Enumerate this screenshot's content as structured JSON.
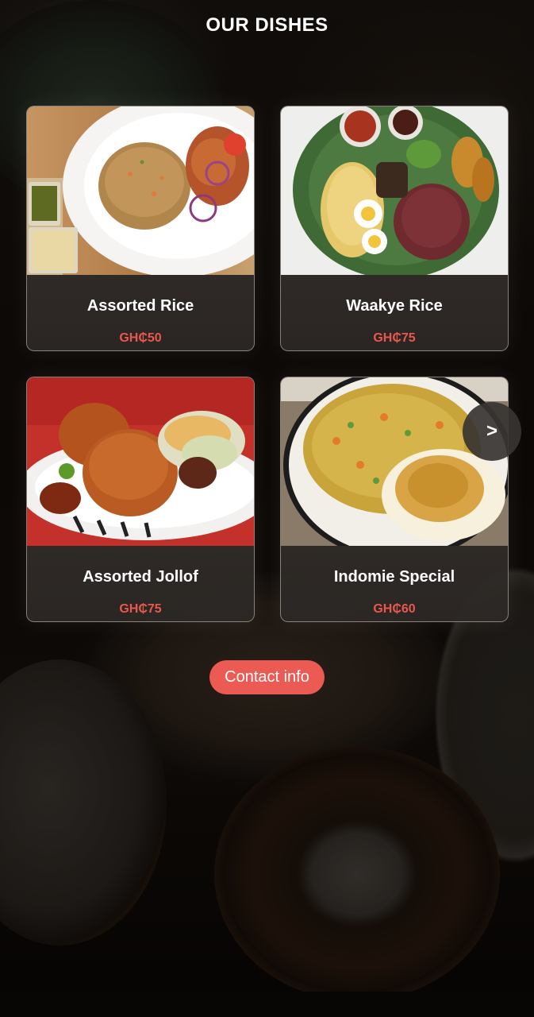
{
  "page": {
    "title": "OUR DISHES"
  },
  "dishes": [
    {
      "name": "Assorted Rice",
      "price": "GH₵50",
      "photo_icon": "fried-rice-plate-photo"
    },
    {
      "name": "Waakye Rice",
      "price": "GH₵75",
      "photo_icon": "waakye-leaf-plate-photo"
    },
    {
      "name": "Assorted Jollof",
      "price": "GH₵75",
      "photo_icon": "jollof-rice-plate-photo"
    },
    {
      "name": "Indomie Special",
      "price": "GH₵60",
      "photo_icon": "noodles-egg-plate-photo"
    }
  ],
  "carousel": {
    "next_label": ">"
  },
  "actions": {
    "contact_label": "Contact info"
  },
  "colors": {
    "accent": "#ec5a54",
    "price": "#e8584e",
    "title": "#ffffff"
  }
}
